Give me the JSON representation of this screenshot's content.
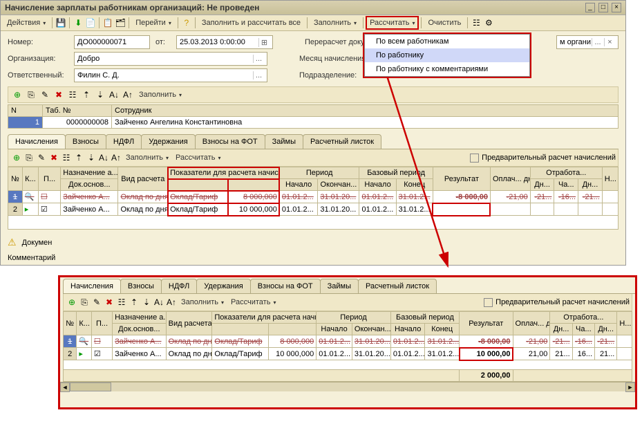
{
  "title": "Начисление зарплаты работникам организаций: Не проведен",
  "toolbar": {
    "actions": "Действия",
    "go": "Перейти",
    "fill_calc_all": "Заполнить и рассчитать все",
    "fill": "Заполнить",
    "calc": "Рассчитать",
    "clear": "Очистить"
  },
  "dropdown": {
    "i1": "По всем работникам",
    "i2": "По работнику",
    "i3": "По работнику с комментариями"
  },
  "form": {
    "number_lbl": "Номер:",
    "number": "ДО000000071",
    "from_lbl": "от:",
    "date": "25.03.2013 0:00:00",
    "recalc_lbl": "Перерасчет докум",
    "org_tag": "м органи",
    "org_lbl": "Организация:",
    "org": "Добро",
    "month_lbl": "Месяц начисления",
    "resp_lbl": "Ответственный:",
    "resp": "Филин С. Д.",
    "dept_lbl": "Подразделение:"
  },
  "emp_toolbar": {
    "fill": "Заполнить"
  },
  "emp_cols": {
    "n": "N",
    "tab": "Таб. №",
    "emp": "Сотрудник"
  },
  "emp_row": {
    "n": "1",
    "tab": "0000000008",
    "name": "Зайченко Ангелина Константиновна"
  },
  "tabs": {
    "t1": "Начисления",
    "t2": "Взносы",
    "t3": "НДФЛ",
    "t4": "Удержания",
    "t5": "Взносы на ФОТ",
    "t6": "Займы",
    "t7": "Расчетный листок"
  },
  "calc_bar": {
    "fill": "Заполнить",
    "calc": "Рассчитать",
    "prelim": "Предварительный расчет начислений"
  },
  "cols": {
    "n": "№",
    "k": "К...",
    "p": "П...",
    "purpose": "Назначение а...",
    "doc": "Док.основ...",
    "calc_type": "Вид расчета",
    "indicators": "Показатели для расчета начисления",
    "period": "Период",
    "start": "Начало",
    "end": "Окончан...",
    "base_period": "Базовый период",
    "bstart": "Начало",
    "bend": "Конец",
    "result": "Результат",
    "paid": "Оплач... дней/ч...",
    "worked": "Отработа...",
    "dn": "Дн...",
    "ch": "Ча...",
    "dn2": "Дн...",
    "h": "Н..."
  },
  "rows": [
    {
      "n": "1",
      "emp": "Зайченко А...",
      "type": "Оклад по дням",
      "ind": "Оклад/Тариф",
      "amt": "8 000,000",
      "ps": "01.01.2...",
      "pe": "31.01.20...",
      "bs": "01.01.2...",
      "be": "31.01.2...",
      "res": "-8 000,00",
      "paid": "-21,00",
      "dn": "-21...",
      "ch": "-16...",
      "dn2": "-21..."
    },
    {
      "n": "2",
      "emp": "Зайченко А...",
      "type": "Оклад по дням",
      "ind": "Оклад/Тариф",
      "amt": "10 000,000",
      "ps": "01.01.2...",
      "pe": "31.01.20...",
      "bs": "01.01.2...",
      "be": "31.01.2...",
      "res": "",
      "paid": "",
      "dn": "",
      "ch": "",
      "dn2": ""
    }
  ],
  "rows2": [
    {
      "n": "1",
      "emp": "Зайченко А...",
      "type": "Оклад по дням",
      "ind": "Оклад/Тариф",
      "amt": "8 000,000",
      "ps": "01.01.2...",
      "pe": "31.01.20...",
      "bs": "01.01.2...",
      "be": "31.01.2...",
      "res": "-8 000,00",
      "paid": "-21,00",
      "dn": "-21...",
      "ch": "-16...",
      "dn2": "-21..."
    },
    {
      "n": "2",
      "emp": "Зайченко А...",
      "type": "Оклад по дням",
      "ind": "Оклад/Тариф",
      "amt": "10 000,000",
      "ps": "01.01.2...",
      "pe": "31.01.20...",
      "bs": "01.01.2...",
      "be": "31.01.2...",
      "res": "10 000,00",
      "paid": "21,00",
      "dn": "21...",
      "ch": "16...",
      "dn2": "21..."
    }
  ],
  "total": "2 000,00",
  "footer": {
    "doc_lbl": "Докумен",
    "comment_lbl": "Комментарий"
  }
}
